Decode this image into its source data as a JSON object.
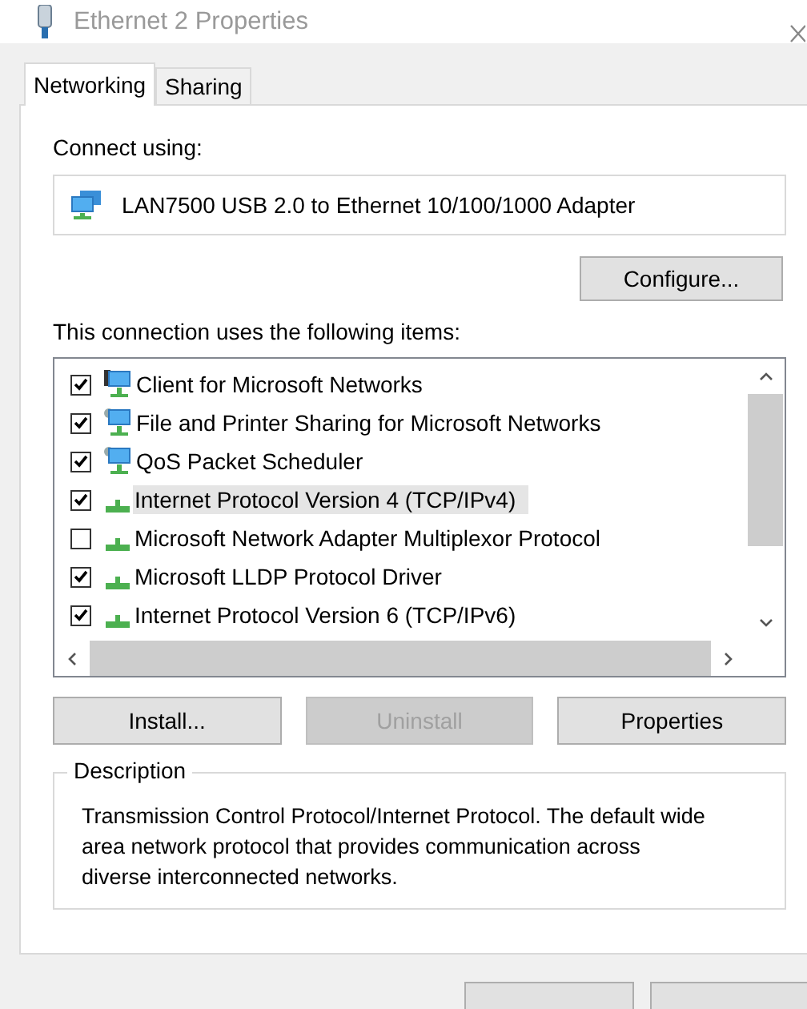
{
  "window": {
    "title": "Ethernet 2 Properties"
  },
  "tabs": [
    {
      "label": "Networking",
      "selected": true
    },
    {
      "label": "Sharing",
      "selected": false
    }
  ],
  "connect_using": {
    "label": "Connect using:",
    "adapter": "LAN7500 USB 2.0 to Ethernet 10/100/1000 Adapter"
  },
  "configure_button": "Configure...",
  "items_label": "This connection uses the following items:",
  "items": [
    {
      "label": "Client for Microsoft Networks",
      "kind": "client",
      "checked": true,
      "selected": false
    },
    {
      "label": "File and Printer Sharing for Microsoft Networks",
      "kind": "service",
      "checked": true,
      "selected": false
    },
    {
      "label": "QoS Packet Scheduler",
      "kind": "service",
      "checked": true,
      "selected": false
    },
    {
      "label": "Internet Protocol Version 4 (TCP/IPv4)",
      "kind": "protocol",
      "checked": true,
      "selected": true
    },
    {
      "label": "Microsoft Network Adapter Multiplexor Protocol",
      "kind": "protocol",
      "checked": false,
      "selected": false
    },
    {
      "label": "Microsoft LLDP Protocol Driver",
      "kind": "protocol",
      "checked": true,
      "selected": false
    },
    {
      "label": "Internet Protocol Version 6 (TCP/IPv6)",
      "kind": "protocol",
      "checked": true,
      "selected": false
    }
  ],
  "buttons": [
    {
      "label": "Install...",
      "disabled": false
    },
    {
      "label": "Uninstall",
      "disabled": true
    },
    {
      "label": "Properties",
      "disabled": false
    }
  ],
  "description": {
    "title": "Description",
    "text": "Transmission Control Protocol/Internet Protocol. The default wide area network protocol that provides communication across diverse interconnected networks."
  }
}
